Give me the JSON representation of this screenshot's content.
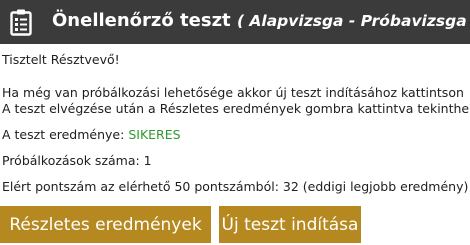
{
  "header": {
    "title": "Önellenőrző teszt",
    "subtitle": "( Alapvizsga - Próbavizsga )",
    "icon": "clipboard-checklist-icon"
  },
  "content": {
    "greeting": "Tisztelt Résztvevő!",
    "info_line1": "Ha még van próbálkozási lehetősége akkor új teszt indításához kattintson",
    "info_line2": "A teszt elvégzése után a Részletes eredmények gombra kattintva tekinthe",
    "result_label": "A teszt eredménye:",
    "result_value": "SIKERES",
    "attempts": "Próbálkozások száma: 1",
    "score": "Elért pontszám az elérhető 50 pontszámból: 32 (eddigi legjobb eredmény)"
  },
  "buttons": {
    "details": "Részletes eredmények",
    "new_test": "Új teszt indítása"
  },
  "colors": {
    "header_bg": "#3b3b3b",
    "button_bg": "#b5891f",
    "success": "#2e9a2e"
  }
}
